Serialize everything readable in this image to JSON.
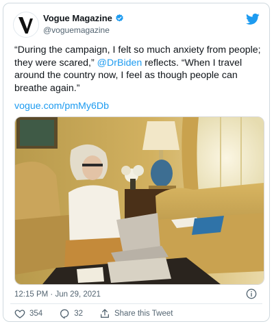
{
  "account": {
    "display_name": "Vogue Magazine",
    "handle": "@voguemagazine",
    "verified": true
  },
  "icons": {
    "avatar": "vogue-logo-v",
    "verified": "verified-badge-icon",
    "brand": "twitter-bird-icon",
    "info": "info-icon",
    "like": "heart-icon",
    "reply": "reply-bubble-icon",
    "share": "share-upload-icon"
  },
  "tweet": {
    "text_line1": "“During the campaign, I felt so much anxiety from people;",
    "text_line2_pre": "they were scared,” ",
    "mention": "@DrBiden",
    "text_line2_post": " reflects. “When I travel",
    "text_line3": "around the country now, I feel as though people can",
    "text_line4": "breathe again.”",
    "link": "vogue.com/pmMy6Db"
  },
  "timestamp": "12:15 PM · Jun 29, 2021",
  "actions": {
    "likes": "354",
    "replies": "32",
    "share_label": "Share this Tweet"
  },
  "colors": {
    "link_blue": "#1d9bf0",
    "text": "#0f1419",
    "muted": "#536471",
    "border": "#cfd9de"
  }
}
